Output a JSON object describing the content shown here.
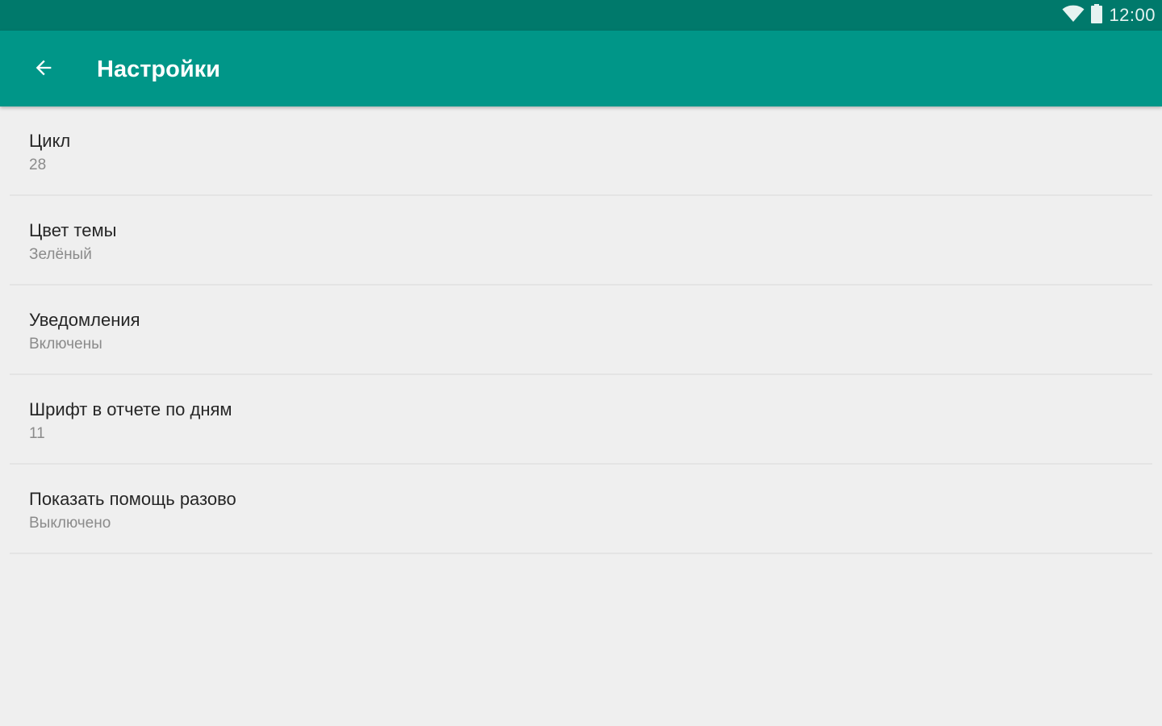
{
  "status_bar": {
    "time": "12:00",
    "icons": [
      "wifi-icon",
      "battery-icon"
    ]
  },
  "app_bar": {
    "title": "Настройки",
    "back_icon": "arrow-back-icon",
    "color": "#009688",
    "status_color": "#00796b"
  },
  "settings": [
    {
      "title": "Цикл",
      "summary": "28"
    },
    {
      "title": "Цвет темы",
      "summary": "Зелёный"
    },
    {
      "title": "Уведомления",
      "summary": "Включены"
    },
    {
      "title": "Шрифт в отчете по дням",
      "summary": "11"
    },
    {
      "title": "Показать помощь разово",
      "summary": "Выключено"
    }
  ]
}
